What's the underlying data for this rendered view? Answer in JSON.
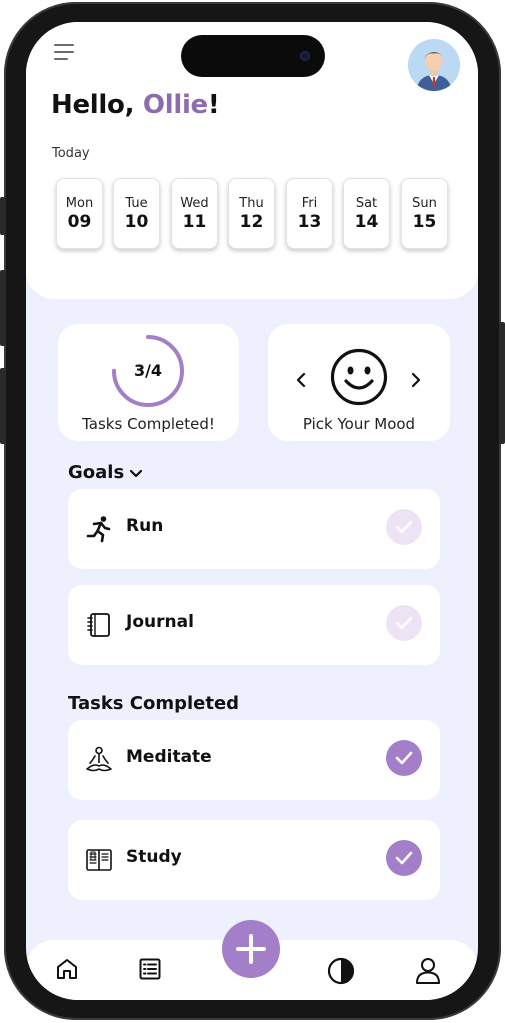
{
  "header": {
    "greeting_prefix": "Hello, ",
    "user_name": "Ollie",
    "greeting_suffix": "!",
    "today_label": "Today"
  },
  "days": [
    {
      "name": "Mon",
      "date": "09",
      "selected": true
    },
    {
      "name": "Tue",
      "date": "10",
      "selected": false
    },
    {
      "name": "Wed",
      "date": "11",
      "selected": false
    },
    {
      "name": "Thu",
      "date": "12",
      "selected": false
    },
    {
      "name": "Fri",
      "date": "13",
      "selected": false
    },
    {
      "name": "Sat",
      "date": "14",
      "selected": false
    },
    {
      "name": "Sun",
      "date": "15",
      "selected": false
    }
  ],
  "progress": {
    "value_text": "3/4",
    "fraction": 0.75,
    "label": "Tasks Completed!"
  },
  "mood": {
    "label": "Pick Your Mood",
    "current_icon": "smiley-face-icon"
  },
  "goals": {
    "title": "Goals",
    "items": [
      {
        "label": "Run",
        "icon": "running-person-icon",
        "done": false
      },
      {
        "label": "Journal",
        "icon": "notebook-icon",
        "done": false
      }
    ]
  },
  "completed": {
    "title": "Tasks Completed",
    "items": [
      {
        "label": "Meditate",
        "icon": "meditation-icon",
        "done": true
      },
      {
        "label": "Study",
        "icon": "open-book-icon",
        "done": true
      }
    ]
  },
  "bottom_nav": {
    "items": [
      "home-icon",
      "list-icon",
      "add-icon",
      "stats-icon",
      "profile-icon"
    ]
  },
  "colors": {
    "accent": "#a27fc8",
    "selected_day": "#c9a8e4",
    "name_highlight": "#8b6cad",
    "background": "#eef1fd",
    "check_pending": "#eee3f5"
  }
}
